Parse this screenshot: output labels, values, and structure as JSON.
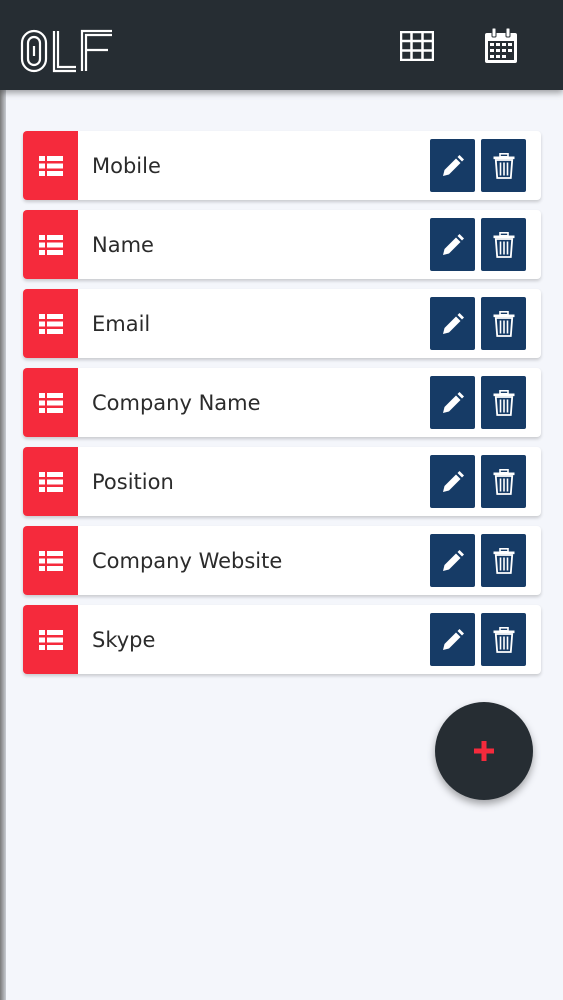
{
  "app": {
    "logo_text": "OLF",
    "icons": {
      "grid": "grid-icon",
      "calendar": "calendar-icon"
    }
  },
  "fields": [
    {
      "label": "Mobile"
    },
    {
      "label": "Name"
    },
    {
      "label": "Email"
    },
    {
      "label": "Company Name"
    },
    {
      "label": "Position"
    },
    {
      "label": "Company Website"
    },
    {
      "label": "Skype"
    }
  ],
  "row_icons": {
    "handle": "list-icon",
    "edit": "pencil-icon",
    "delete": "trash-icon"
  },
  "fab": {
    "icon": "plus-icon"
  },
  "colors": {
    "app_bar": "#262d33",
    "handle_red": "#f52a3c",
    "action_navy": "#163b66",
    "background": "#f4f6fb",
    "fab_plus": "#f52a3c"
  }
}
